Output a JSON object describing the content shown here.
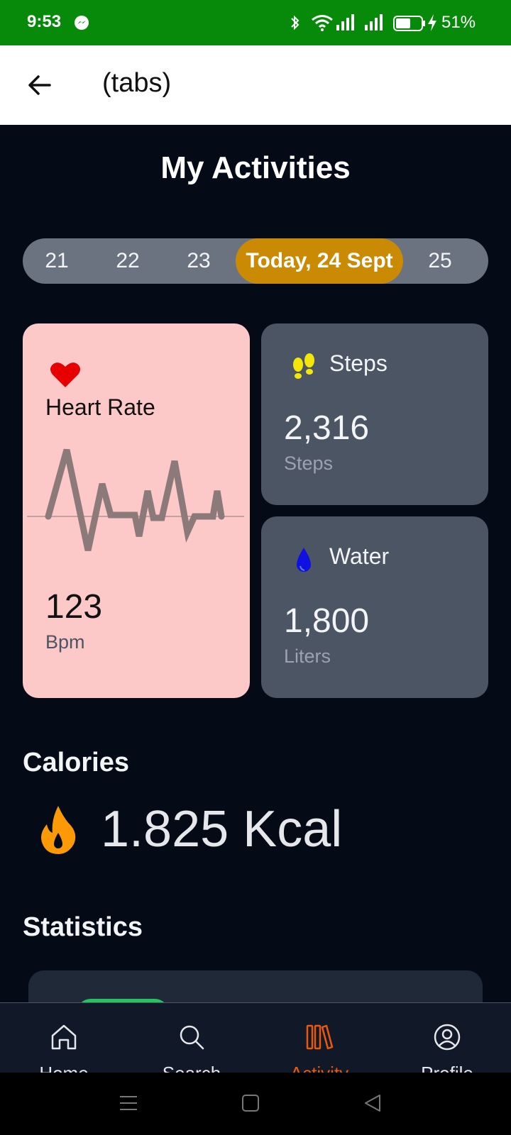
{
  "status_bar": {
    "time": "9:53",
    "battery": "51%"
  },
  "header": {
    "title": "(tabs)"
  },
  "page": {
    "title": "My Activities"
  },
  "dates": [
    {
      "label": "21",
      "selected": false
    },
    {
      "label": "22",
      "selected": false
    },
    {
      "label": "23",
      "selected": false
    },
    {
      "label": "Today, 24 Sept",
      "selected": true
    },
    {
      "label": "25",
      "selected": false
    }
  ],
  "cards": {
    "heart": {
      "title": "Heart Rate",
      "value": "123",
      "unit": "Bpm"
    },
    "steps": {
      "title": "Steps",
      "value": "2,316",
      "unit": "Steps"
    },
    "water": {
      "title": "Water",
      "value": "1,800",
      "unit": "Liters"
    }
  },
  "calories": {
    "title": "Calories",
    "value": "1.825 Kcal"
  },
  "statistics": {
    "title": "Statistics"
  },
  "tabs": [
    {
      "label": "Home",
      "icon": "home-icon",
      "active": false
    },
    {
      "label": "Search",
      "icon": "search-icon",
      "active": false
    },
    {
      "label": "Activity",
      "icon": "activity-icon",
      "active": true
    },
    {
      "label": "Profile",
      "icon": "profile-icon",
      "active": false
    }
  ],
  "colors": {
    "status_bar": "#078a0a",
    "accent": "#ca8a04",
    "active_tab": "#ea580c",
    "heart_card": "#fcc8c8",
    "card": "#4b5563"
  }
}
